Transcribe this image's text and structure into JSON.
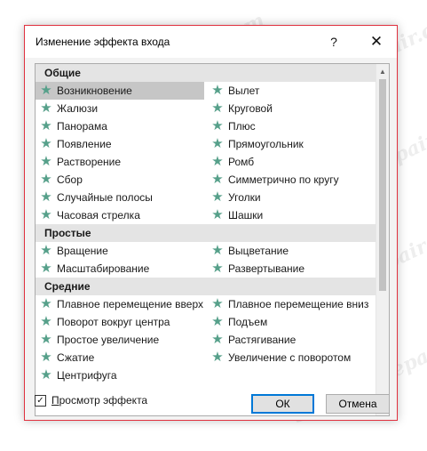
{
  "dialog": {
    "title": "Изменение эффекта входа",
    "help_label": "?",
    "close_label": "✕"
  },
  "groups": [
    {
      "label": "Общие",
      "items": [
        {
          "label": "Возникновение",
          "selected": true
        },
        {
          "label": "Вылет"
        },
        {
          "label": "Жалюзи"
        },
        {
          "label": "Круговой"
        },
        {
          "label": "Панорама"
        },
        {
          "label": "Плюс"
        },
        {
          "label": "Появление"
        },
        {
          "label": "Прямоугольник"
        },
        {
          "label": "Растворение"
        },
        {
          "label": "Ромб"
        },
        {
          "label": "Сбор"
        },
        {
          "label": "Симметрично по кругу"
        },
        {
          "label": "Случайные полосы"
        },
        {
          "label": "Уголки"
        },
        {
          "label": "Часовая стрелка"
        },
        {
          "label": "Шашки"
        }
      ]
    },
    {
      "label": "Простые",
      "items": [
        {
          "label": "Вращение"
        },
        {
          "label": "Выцветание"
        },
        {
          "label": "Масштабирование"
        },
        {
          "label": "Развертывание"
        }
      ]
    },
    {
      "label": "Средние",
      "items": [
        {
          "label": "Плавное перемещение вверх"
        },
        {
          "label": "Плавное перемещение вниз"
        },
        {
          "label": "Поворот вокруг центра"
        },
        {
          "label": "Подъем"
        },
        {
          "label": "Простое увеличение"
        },
        {
          "label": "Растягивание"
        },
        {
          "label": "Сжатие"
        },
        {
          "label": "Увеличение с поворотом"
        },
        {
          "label": "Центрифуга"
        }
      ]
    }
  ],
  "preview": {
    "label_underlined": "П",
    "label_rest": "росмотр эффекта",
    "checked": true,
    "check_glyph": "✓"
  },
  "buttons": {
    "ok_label": "ОК",
    "cancel_label": "Отмена"
  },
  "icons": {
    "effect": "star-icon",
    "star_glyph": "★",
    "scroll_up_glyph": "▲",
    "scroll_down_glyph": "▼"
  },
  "colors": {
    "star": "#56a08a",
    "selected_bg": "#c6c6c6",
    "group_bg": "#e4e4e4",
    "ok_border": "#0078d7",
    "dialog_border": "#e0313f"
  },
  "watermark": "Soringpcrepair.com"
}
